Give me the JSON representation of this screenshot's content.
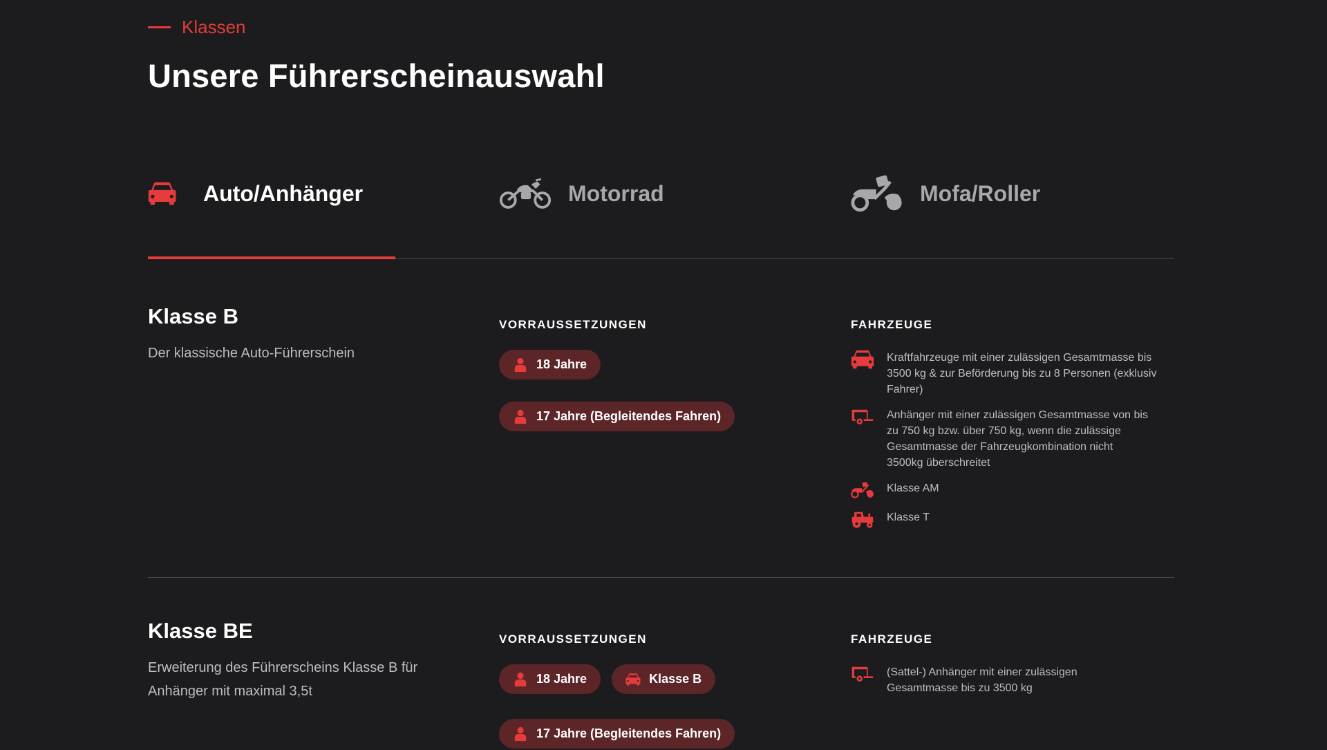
{
  "header": {
    "eyebrow": "Klassen",
    "title": "Unsere Führerscheinauswahl"
  },
  "tabs": [
    {
      "label": "Auto/Anhänger",
      "icon": "car-icon",
      "active": true
    },
    {
      "label": "Motorrad",
      "icon": "motorcycle-icon",
      "active": false
    },
    {
      "label": "Mofa/Roller",
      "icon": "scooter-icon",
      "active": false
    }
  ],
  "classes": [
    {
      "title": "Klasse B",
      "description": "Der klassische Auto-Führerschein",
      "requirements_heading": "VORRAUSSETZUNGEN",
      "requirements": [
        {
          "label": "18 Jahre",
          "icon": "person-icon"
        },
        {
          "label": "17 Jahre (Begleitendes Fahren)",
          "icon": "person-icon"
        }
      ],
      "vehicles_heading": "FAHRZEUGE",
      "vehicles": [
        {
          "icon": "car-icon",
          "text": "Kraftfahrzeuge mit einer zulässigen Gesamtmasse bis 3500 kg & zur Beförderung bis zu 8 Personen (exklusiv Fahrer)"
        },
        {
          "icon": "trailer-icon",
          "text": "Anhänger mit einer zulässigen Gesamtmasse von bis zu 750 kg bzw. über 750 kg, wenn die zulässige Gesamtmasse der Fahrzeugkombination nicht 3500kg überschreitet"
        },
        {
          "icon": "scooter-icon",
          "text": "Klasse AM"
        },
        {
          "icon": "tractor-icon",
          "text": "Klasse T"
        }
      ]
    },
    {
      "title": "Klasse BE",
      "description": "Erweiterung des Führerscheins Klasse B für Anhänger mit maximal 3,5t",
      "requirements_heading": "VORRAUSSETZUNGEN",
      "requirements": [
        {
          "label": "18 Jahre",
          "icon": "person-icon"
        },
        {
          "label": "Klasse B",
          "icon": "car-icon"
        },
        {
          "label": "17 Jahre (Begleitendes Fahren)",
          "icon": "person-icon"
        }
      ],
      "vehicles_heading": "FAHRZEUGE",
      "vehicles": [
        {
          "icon": "trailer-icon",
          "text": "(Sattel-) Anhänger mit einer zulässigen Gesamtmasse bis zu 3500 kg"
        }
      ]
    }
  ],
  "colors": {
    "accent": "#e63b3b",
    "background": "#1c1c1e",
    "badge_bg": "#5c2528",
    "inactive_tab": "#a8a8ab"
  }
}
